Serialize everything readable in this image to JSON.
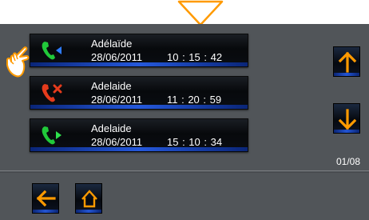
{
  "calls": [
    {
      "name": "Adélaïde",
      "date": "28/06/2011",
      "time": "10 : 15 : 42",
      "icon": "incoming-call-icon"
    },
    {
      "name": "Adelaide",
      "date": "28/06/2011",
      "time": "11 : 20 : 59",
      "icon": "missed-call-icon"
    },
    {
      "name": "Adelaide",
      "date": "28/06/2011",
      "time": "15 : 10 : 34",
      "icon": "outgoing-call-icon"
    }
  ],
  "pagination": {
    "indicator": "01/08"
  },
  "colors": {
    "accent": "#ff9a00",
    "phone_green": "#21c93a",
    "missed_red": "#e53b1c",
    "incoming_blue": "#2e7bff",
    "outgoing_green": "#2ee04c",
    "background": "#515559"
  }
}
